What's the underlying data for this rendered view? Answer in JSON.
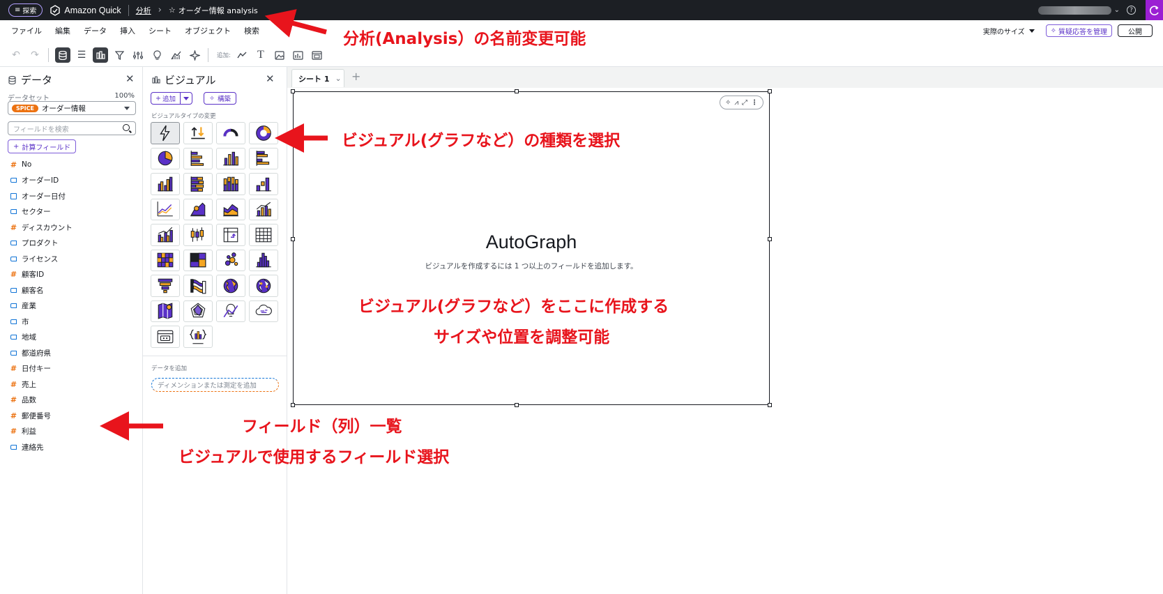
{
  "topbar": {
    "explore_label": "探索",
    "app_name": "Amazon Quick",
    "breadcrumb_analysis": "分析",
    "analysis_title": "オーダー情報 analysis"
  },
  "menu": [
    "ファイル",
    "編集",
    "データ",
    "挿入",
    "シート",
    "オブジェクト",
    "検索"
  ],
  "menubar_right": {
    "size_label": "実際のサイズ",
    "qa_button": "質疑応答を管理",
    "publish_button": "公開"
  },
  "toolbar": {
    "add_label": "追加:"
  },
  "data_panel": {
    "title": "データ",
    "dataset_label": "データセット",
    "dataset_percent": "100%",
    "spice_badge": "SPICE",
    "dataset_name": "オーダー情報",
    "search_placeholder": "フィールドを検索",
    "calc_field_button": "計算フィールド",
    "fields": [
      {
        "name": "No",
        "type": "number"
      },
      {
        "name": "オーダーID",
        "type": "dimension"
      },
      {
        "name": "オーダー日付",
        "type": "date"
      },
      {
        "name": "セクター",
        "type": "dimension"
      },
      {
        "name": "ディスカウント",
        "type": "number"
      },
      {
        "name": "プロダクト",
        "type": "dimension"
      },
      {
        "name": "ライセンス",
        "type": "dimension"
      },
      {
        "name": "顧客ID",
        "type": "number"
      },
      {
        "name": "顧客名",
        "type": "dimension"
      },
      {
        "name": "産業",
        "type": "dimension"
      },
      {
        "name": "市",
        "type": "dimension"
      },
      {
        "name": "地域",
        "type": "dimension"
      },
      {
        "name": "都道府県",
        "type": "dimension"
      },
      {
        "name": "日付キー",
        "type": "number"
      },
      {
        "name": "売上",
        "type": "number"
      },
      {
        "name": "品数",
        "type": "number"
      },
      {
        "name": "郵便番号",
        "type": "number"
      },
      {
        "name": "利益",
        "type": "number"
      },
      {
        "name": "連絡先",
        "type": "dimension"
      }
    ]
  },
  "visual_panel": {
    "title": "ビジュアル",
    "add_button": "追加",
    "build_button": "構築",
    "visual_type_label": "ビジュアルタイプの変更",
    "add_data_label": "データを追加",
    "add_data_placeholder": "ディメンションまたは測定を追加"
  },
  "canvas": {
    "sheet_tab": "シート 1",
    "visual_title": "AutoGraph",
    "visual_subtitle": "ビジュアルを作成するには 1 つ以上のフィールドを追加します。"
  },
  "annotations": {
    "analysis_rename": "分析(Analysis）の名前変更可能",
    "visual_type": "ビジュアル(グラフなど）の種類を選択",
    "create_here": "ビジュアル(グラフなど）をここに作成する",
    "resize": "サイズや位置を調整可能",
    "field_list": "フィールド（列）一覧",
    "field_select": "ビジュアルで使用するフィールド選択"
  },
  "colors": {
    "accent": "#5a31c7",
    "annotation": "#e8141c",
    "number_field": "#ec7211",
    "dimension_field": "#0f73d6"
  }
}
